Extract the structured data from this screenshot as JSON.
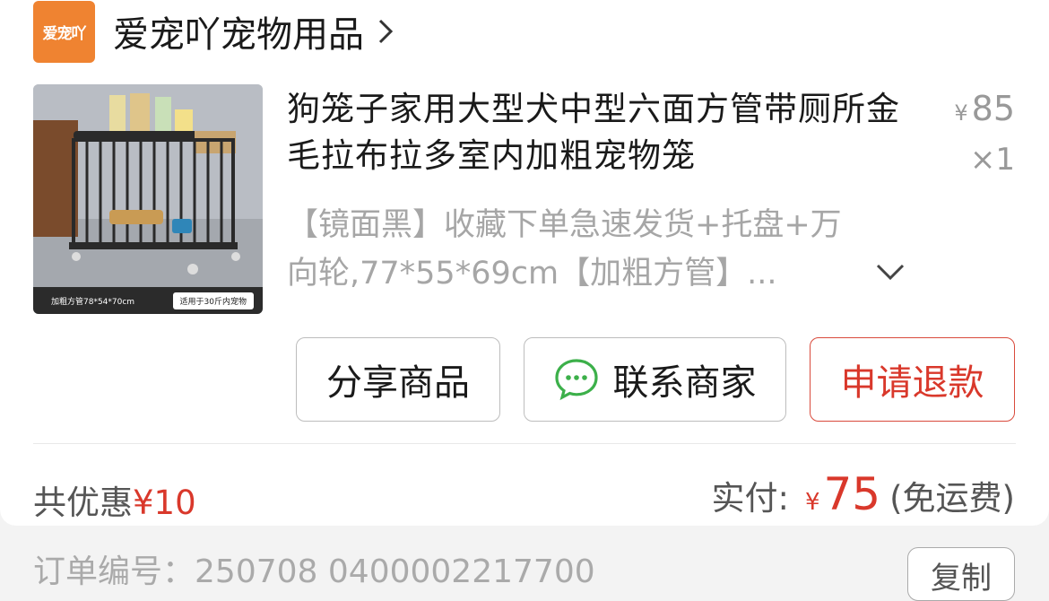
{
  "shop": {
    "logo_text": "爱宠吖",
    "name": "爱宠吖宠物用品",
    "arrow_icon": "chevron-right-icon"
  },
  "product": {
    "title": "狗笼子家用大型犬中型六面方管带厕所金毛拉布拉多室内加粗宠物笼",
    "price_symbol": "¥",
    "price": "85",
    "quantity": "×1",
    "sku": "【镜面黑】收藏下单急速发货+托盘+万向轮,77*55*69cm【加粗方管】...",
    "image_caption_left": "加粗方管78*54*70cm",
    "image_caption_right": "适用于30斤内宠物"
  },
  "actions": {
    "share": "分享商品",
    "contact": "联系商家",
    "refund": "申请退款"
  },
  "summary": {
    "discount_label": "共优惠",
    "discount_amount": "¥10",
    "paid_label": "实付:",
    "paid_symbol": "¥",
    "paid_amount": "75",
    "paid_note": "(免运费)"
  },
  "order": {
    "label": "订单编号：",
    "number": "250708 0400002217700",
    "copy_label": "复制"
  },
  "colors": {
    "accent_red": "#d9382b",
    "logo_orange": "#ef8331",
    "wechat_green": "#3cb04a"
  }
}
